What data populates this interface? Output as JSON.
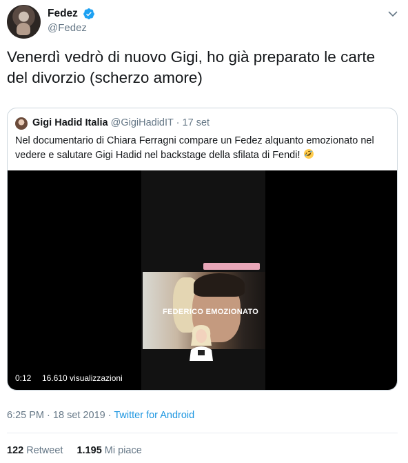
{
  "author": {
    "name": "Fedez",
    "handle": "@Fedez",
    "verified": true
  },
  "tweet": {
    "text": "Venerdì vedrò di nuovo Gigi, ho già preparato le carte del divorzio (scherzo amore)"
  },
  "quoted": {
    "name": "Gigi Hadid Italia",
    "handle": "@GigiHadidIT",
    "separator": "·",
    "date": "17 set",
    "text": "Nel documentario di Chiara Ferragni compare un Fedez alquanto emozionato nel vedere e salutare Gigi Hadid nel backstage della sfilata di Fendi!",
    "emoji": "rolling-on-floor-laughing"
  },
  "video": {
    "overlay_text": "FEDERICO EMOZIONATO",
    "duration": "0:12",
    "views": "16.610 visualizzazioni"
  },
  "meta": {
    "time": "6:25 PM",
    "separator": "·",
    "date": "18 set 2019",
    "separator2": "·",
    "source": "Twitter for Android"
  },
  "stats": {
    "retweets_count": "122",
    "retweets_label": "Retweet",
    "likes_count": "1.195",
    "likes_label": "Mi piace"
  },
  "colors": {
    "text_primary": "#14171a",
    "text_secondary": "#657786",
    "link": "#1b95e0",
    "verified": "#1da1f2",
    "border": "#ccd6dd"
  },
  "icons": {
    "verified": "verified-badge-icon",
    "menu": "chevron-down-icon"
  }
}
